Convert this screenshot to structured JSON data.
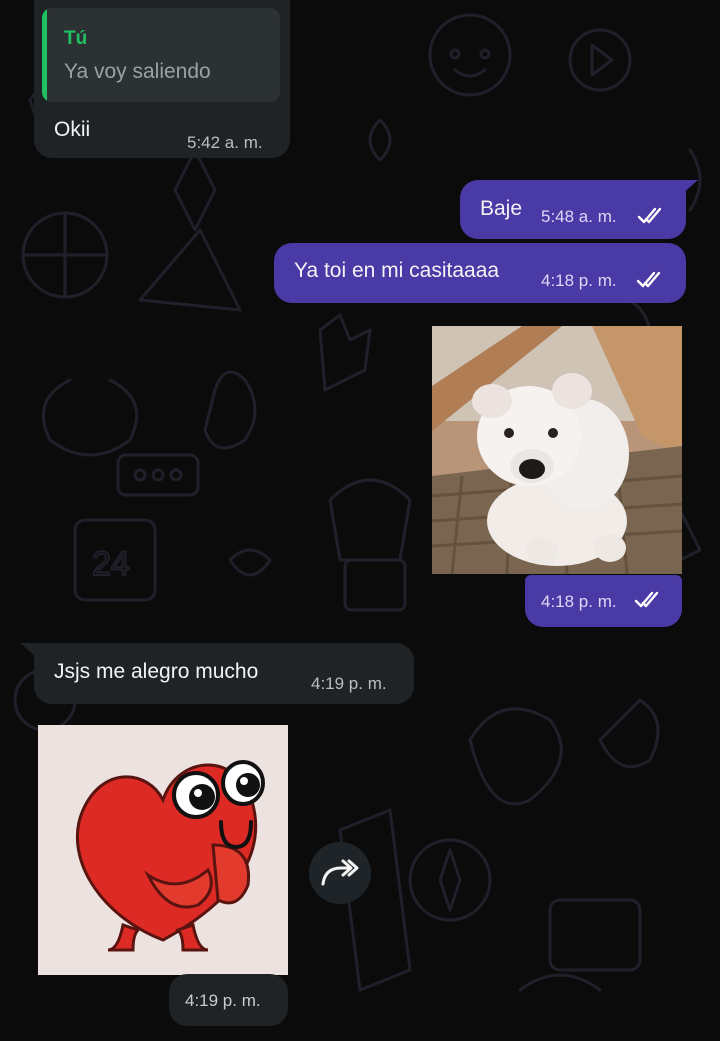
{
  "chat": {
    "messages": [
      {
        "direction": "incoming",
        "quoted": {
          "author": "Tú",
          "text": "Ya voy saliendo"
        },
        "text": "Okii",
        "time": "5:42 a. m."
      },
      {
        "direction": "outgoing",
        "text": "Baje",
        "time": "5:48 a. m.",
        "status": "read"
      },
      {
        "direction": "outgoing",
        "text": "Ya toi en mi casitaaaa",
        "time": "4:18 p. m.",
        "status": "read"
      },
      {
        "direction": "outgoing",
        "media": "photo",
        "subject": "white-puppy",
        "time": "4:18 p. m.",
        "status": "read"
      },
      {
        "direction": "incoming",
        "text": "Jsjs me alegro mucho",
        "time": "4:19 p. m."
      },
      {
        "direction": "incoming",
        "media": "sticker",
        "subject": "red-heart-character",
        "time": "4:19 p. m."
      }
    ]
  },
  "icons": {
    "read_receipt": "double-check-icon",
    "forward": "forward-arrow-icon"
  },
  "colors": {
    "background": "#0b0b0c",
    "incoming_bubble": "#1f2326",
    "outgoing_bubble": "#4a3aa6",
    "quote_accent": "#21c063",
    "read_tick": "#ffffff"
  }
}
